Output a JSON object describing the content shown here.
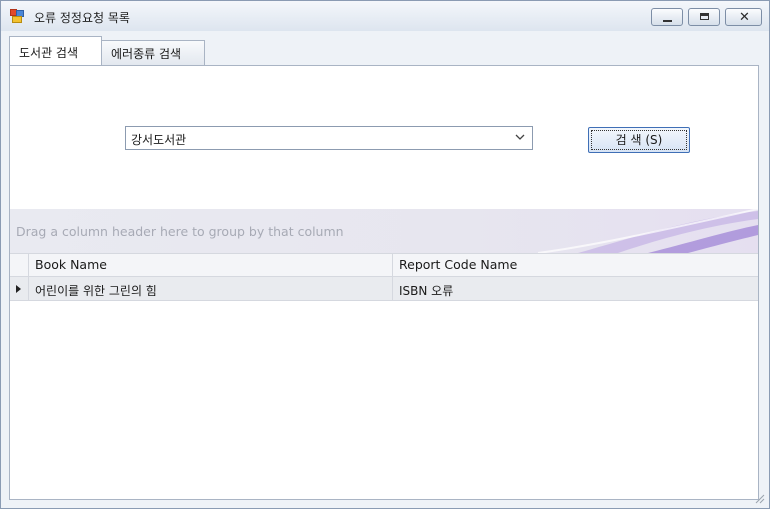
{
  "window": {
    "title": "오류 정정요청 목록",
    "minimize_glyph": "",
    "maximize_glyph": "",
    "close_glyph": "✕"
  },
  "tabs": [
    {
      "label": "도서관 검색",
      "active": true
    },
    {
      "label": "에러종류 검색",
      "active": false
    }
  ],
  "search": {
    "library_value": "강서도서관",
    "button_label": "검 색 (S)"
  },
  "grid": {
    "group_panel_text": "Drag a column header here to group by that column",
    "columns": [
      "Book Name",
      "Report Code Name"
    ],
    "rows": [
      {
        "book_name": "어린이를 위한 그린의 힘",
        "report_code_name": "ISBN 오류"
      }
    ]
  },
  "colors": {
    "accent": "#3f6fb6",
    "group_panel_swoosh": "#b39ddb"
  }
}
